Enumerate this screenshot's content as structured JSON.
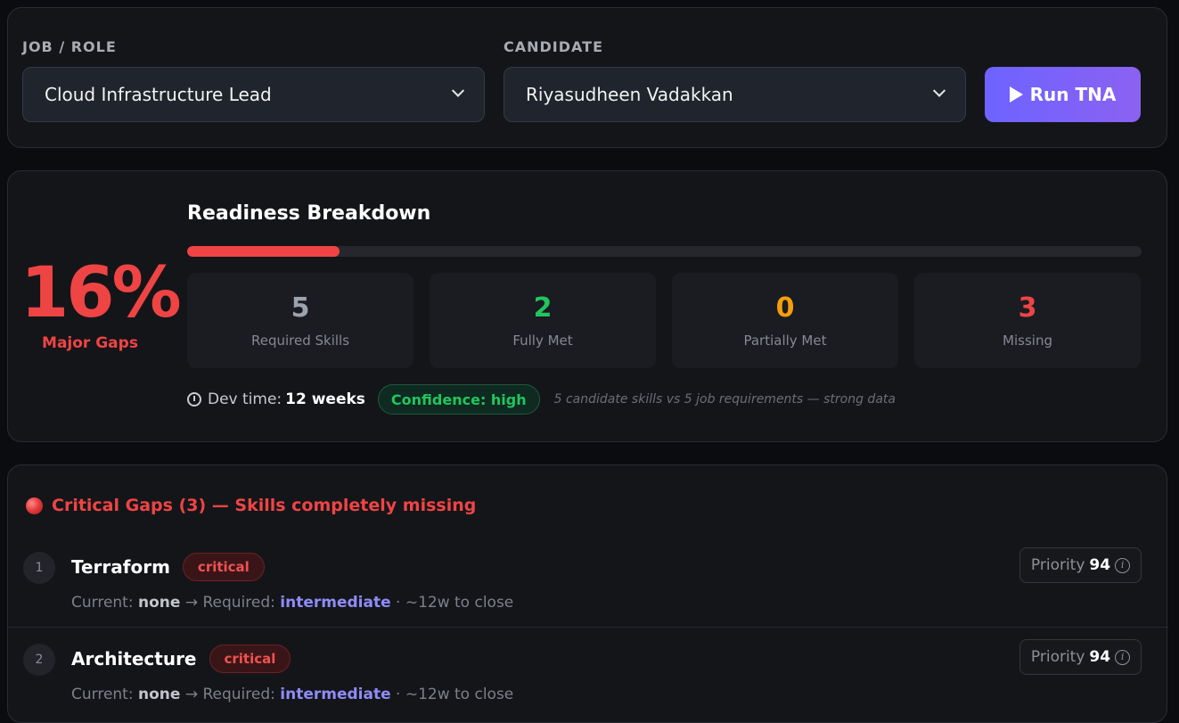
{
  "selector": {
    "job_label": "JOB / ROLE",
    "job_value": "Cloud Infrastructure Lead",
    "candidate_label": "CANDIDATE",
    "candidate_value": "Riyasudheen Vadakkan",
    "run_button": "Run TNA"
  },
  "readiness": {
    "percent": "16%",
    "percent_value": 16,
    "verdict": "Major Gaps",
    "title": "Readiness Breakdown",
    "stats": [
      {
        "value": "5",
        "label": "Required Skills",
        "color": "#9ca3af"
      },
      {
        "value": "2",
        "label": "Fully Met",
        "color": "#22c55e"
      },
      {
        "value": "0",
        "label": "Partially Met",
        "color": "#f59e0b"
      },
      {
        "value": "3",
        "label": "Missing",
        "color": "#ef4444"
      }
    ],
    "dev_time_label": "Dev time:",
    "dev_time_value": "12 weeks",
    "confidence": "Confidence: high",
    "confidence_note": "5 candidate skills vs 5 job requirements — strong data"
  },
  "critical_gaps": {
    "title": "Critical Gaps (3) — Skills completely missing",
    "current_label": "Current:",
    "required_label": "→ Required:",
    "priority_label": "Priority",
    "items": [
      {
        "index": "1",
        "name": "Terraform",
        "severity": "critical",
        "current": "none",
        "required": "intermediate",
        "close_time": "· ~12w to close",
        "priority": "94"
      },
      {
        "index": "2",
        "name": "Architecture",
        "severity": "critical",
        "current": "none",
        "required": "intermediate",
        "close_time": "· ~12w to close",
        "priority": "94"
      }
    ]
  },
  "colors": {
    "accent": "#6d63ff",
    "danger": "#ef4444",
    "success": "#22c55e",
    "warning": "#f59e0b"
  }
}
